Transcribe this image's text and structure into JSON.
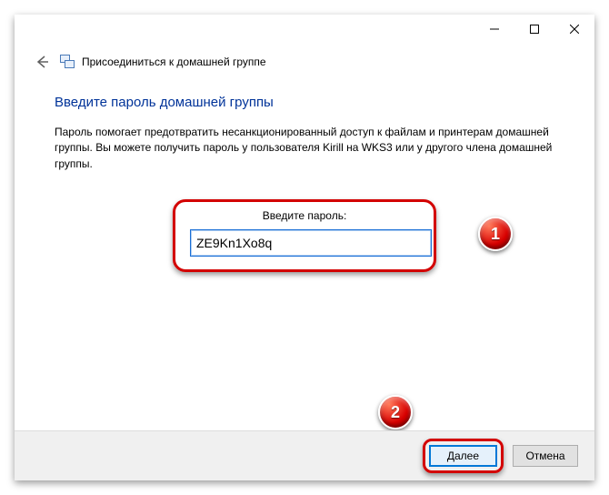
{
  "window": {
    "title": "Присоединиться к домашней группе"
  },
  "page": {
    "heading": "Введите пароль домашней группы",
    "description": "Пароль помогает предотвратить несанкционированный доступ к файлам и принтерам домашней группы. Вы можете получить пароль у пользователя Kirill на WKS3 или у другого члена домашней группы.",
    "password_label": "Введите пароль:",
    "password_value": "ZE9Kn1Xo8q"
  },
  "buttons": {
    "next": "Далее",
    "cancel": "Отмена"
  },
  "annotations": {
    "step1": "1",
    "step2": "2"
  }
}
